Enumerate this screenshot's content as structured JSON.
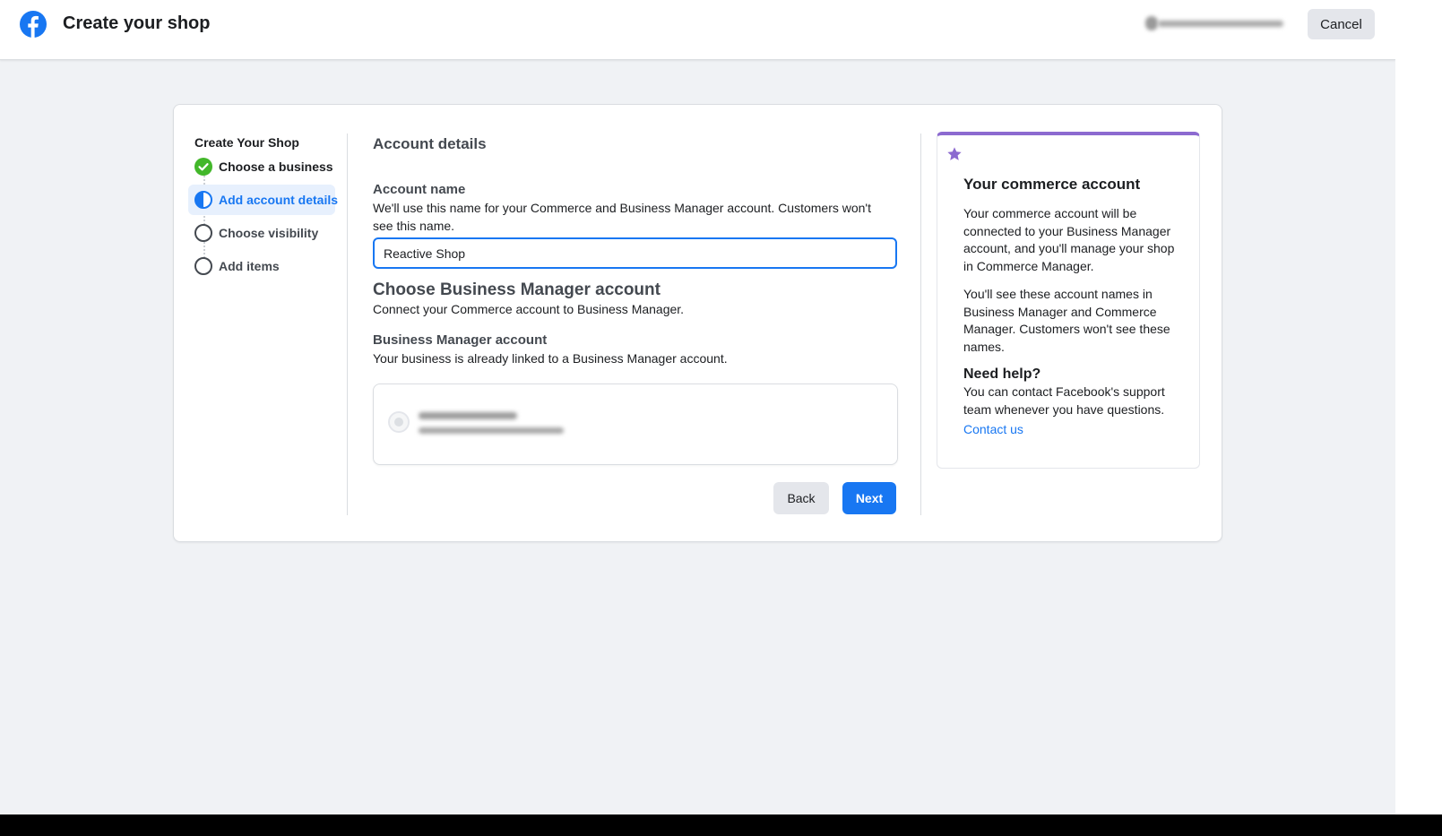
{
  "header": {
    "title": "Create your shop",
    "cancel_label": "Cancel"
  },
  "steps": {
    "title": "Create Your Shop",
    "items": [
      {
        "label": "Choose a business",
        "state": "done"
      },
      {
        "label": "Add account details",
        "state": "active"
      },
      {
        "label": "Choose visibility",
        "state": "pending"
      },
      {
        "label": "Add items",
        "state": "pending"
      }
    ]
  },
  "main": {
    "section_title": "Account details",
    "account_name": {
      "label": "Account name",
      "help": "We'll use this name for your Commerce and Business Manager account. Customers won't see this name.",
      "value": "Reactive Shop"
    },
    "bm": {
      "heading": "Choose Business Manager account",
      "subheading": "Connect your Commerce account to Business Manager.",
      "label": "Business Manager account",
      "help": "Your business is already linked to a Business Manager account."
    },
    "back_label": "Back",
    "next_label": "Next"
  },
  "info": {
    "title": "Your commerce account",
    "para1": "Your commerce account will be connected to your Business Manager account, and you'll manage your shop in Commerce Manager.",
    "para2": "You'll see these account names in Business Manager and Commerce Manager. Customers won't see these names.",
    "help_title": "Need help?",
    "help_text": "You can contact Facebook's support team whenever you have questions.",
    "contact_label": "Contact us"
  },
  "colors": {
    "brand": "#1877f2",
    "success": "#42b72a",
    "accent": "#8c6ad0"
  }
}
